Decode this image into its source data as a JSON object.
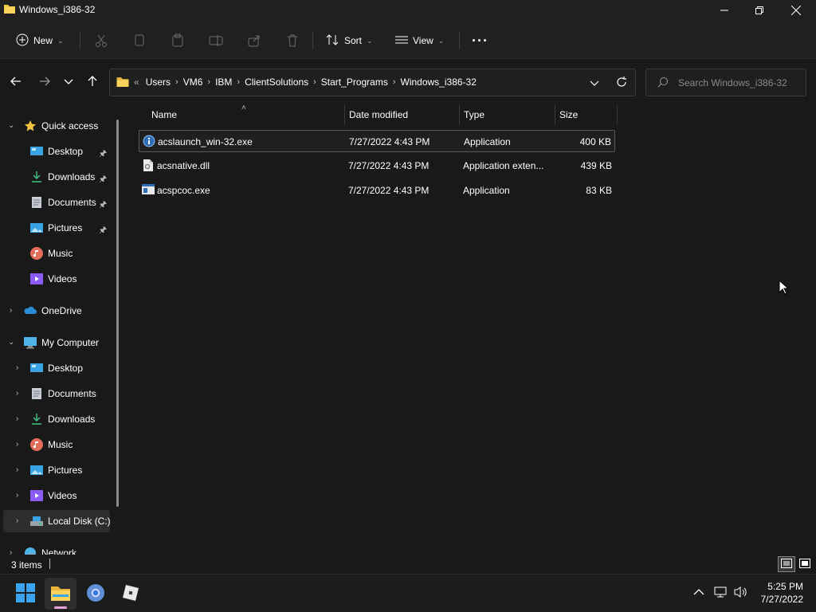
{
  "window": {
    "title": "Windows_i386-32",
    "minimize_icon": "minimize-icon",
    "restore_icon": "restore-icon",
    "close_icon": "close-icon"
  },
  "toolbar": {
    "new_label": "New",
    "sort_label": "Sort",
    "view_label": "View",
    "more_label": "···",
    "disabled_icons": [
      "cut-icon",
      "copy-icon",
      "paste-icon",
      "rename-icon",
      "share-icon",
      "delete-icon"
    ]
  },
  "address": {
    "overflow": "«",
    "crumbs": [
      "Users",
      "VM6",
      "IBM",
      "ClientSolutions",
      "Start_Programs",
      "Windows_i386-32"
    ]
  },
  "search": {
    "placeholder": "Search Windows_i386-32"
  },
  "sidebar": {
    "quick_access": "Quick access",
    "quick_items": [
      {
        "label": "Desktop",
        "icon": "desktop-icon",
        "pinned": true
      },
      {
        "label": "Downloads",
        "icon": "downloads-icon",
        "pinned": true
      },
      {
        "label": "Documents",
        "icon": "documents-icon",
        "pinned": true
      },
      {
        "label": "Pictures",
        "icon": "pictures-icon",
        "pinned": true
      },
      {
        "label": "Music",
        "icon": "music-icon",
        "pinned": false
      },
      {
        "label": "Videos",
        "icon": "videos-icon",
        "pinned": false
      }
    ],
    "onedrive": "OneDrive",
    "my_computer": "My Computer",
    "computer_items": [
      {
        "label": "Desktop",
        "icon": "desktop-icon"
      },
      {
        "label": "Documents",
        "icon": "documents-icon"
      },
      {
        "label": "Downloads",
        "icon": "downloads-icon"
      },
      {
        "label": "Music",
        "icon": "music-icon"
      },
      {
        "label": "Pictures",
        "icon": "pictures-icon"
      },
      {
        "label": "Videos",
        "icon": "videos-icon"
      },
      {
        "label": "Local Disk (C:)",
        "icon": "local-disk-icon"
      }
    ],
    "network": "Network"
  },
  "columns": {
    "name": "Name",
    "date": "Date modified",
    "type": "Type",
    "size": "Size"
  },
  "files": [
    {
      "name": "acslaunch_win-32.exe",
      "date": "7/27/2022 4:43 PM",
      "type": "Application",
      "size": "400 KB",
      "icon": "info-app-icon"
    },
    {
      "name": "acsnative.dll",
      "date": "7/27/2022 4:43 PM",
      "type": "Application exten...",
      "size": "439 KB",
      "icon": "dll-file-icon"
    },
    {
      "name": "acspcoc.exe",
      "date": "7/27/2022 4:43 PM",
      "type": "Application",
      "size": "83 KB",
      "icon": "exe-window-icon"
    }
  ],
  "status": {
    "items_text": "3 items"
  },
  "taskbar": {
    "apps": [
      "start-icon",
      "file-explorer-icon",
      "chrome-icon",
      "roblox-icon"
    ],
    "time": "5:25 PM",
    "date": "7/27/2022"
  },
  "colors": {
    "accent": "#4cc2ff",
    "folder": "#f4c542",
    "background": "#191919"
  }
}
